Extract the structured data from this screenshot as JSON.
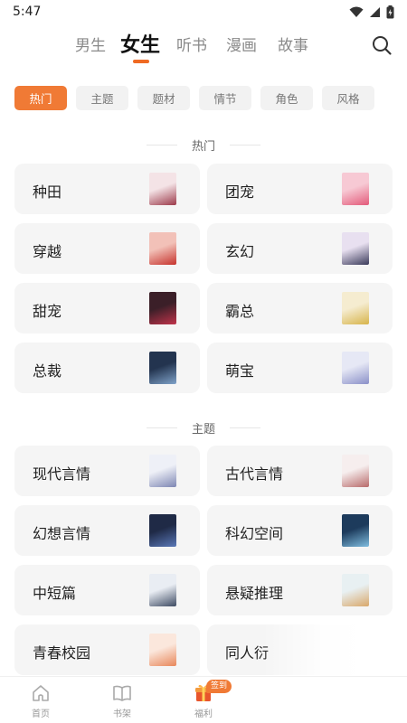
{
  "status_bar": {
    "time": "5:47"
  },
  "top_tabs": [
    {
      "label": "男生",
      "active": false
    },
    {
      "label": "女生",
      "active": true
    },
    {
      "label": "听书",
      "active": false
    },
    {
      "label": "漫画",
      "active": false
    },
    {
      "label": "故事",
      "active": false
    }
  ],
  "filter_chips": [
    {
      "label": "热门",
      "active": true
    },
    {
      "label": "主题",
      "active": false
    },
    {
      "label": "题材",
      "active": false
    },
    {
      "label": "情节",
      "active": false
    },
    {
      "label": "角色",
      "active": false
    },
    {
      "label": "风格",
      "active": false
    }
  ],
  "sections": [
    {
      "title": "热门",
      "items": [
        {
          "label": "种田",
          "cover_colors": [
            "#f4e3e6",
            "#9c3a4a"
          ]
        },
        {
          "label": "团宠",
          "cover_colors": [
            "#f7c9d4",
            "#e35a7a"
          ]
        },
        {
          "label": "穿越",
          "cover_colors": [
            "#f2c1b8",
            "#c6332d"
          ]
        },
        {
          "label": "玄幻",
          "cover_colors": [
            "#e8e0f0",
            "#3a3a5a"
          ]
        },
        {
          "label": "甜宠",
          "cover_colors": [
            "#3b1f28",
            "#c0334a"
          ]
        },
        {
          "label": "霸总",
          "cover_colors": [
            "#f5ecd0",
            "#d7b44a"
          ]
        },
        {
          "label": "总裁",
          "cover_colors": [
            "#23344f",
            "#7fa2c9"
          ]
        },
        {
          "label": "萌宝",
          "cover_colors": [
            "#e6e8f5",
            "#8a90c8"
          ]
        }
      ]
    },
    {
      "title": "主题",
      "items": [
        {
          "label": "现代言情",
          "cover_colors": [
            "#eef0f7",
            "#7d86b3"
          ]
        },
        {
          "label": "古代言情",
          "cover_colors": [
            "#f6eeee",
            "#b86a6a"
          ]
        },
        {
          "label": "幻想言情",
          "cover_colors": [
            "#1f2a46",
            "#5a78b8"
          ]
        },
        {
          "label": "科幻空间",
          "cover_colors": [
            "#1d3b5c",
            "#7fbde0"
          ]
        },
        {
          "label": "中短篇",
          "cover_colors": [
            "#e9edf3",
            "#3d4a62"
          ]
        },
        {
          "label": "悬疑推理",
          "cover_colors": [
            "#e8f0f2",
            "#d9a86a"
          ]
        },
        {
          "label": "青春校园",
          "cover_colors": [
            "#fbe7dc",
            "#e8875a"
          ]
        },
        {
          "label": "同人衍",
          "cover_colors": [
            "#ffffff",
            "#ffffff"
          ]
        }
      ]
    }
  ],
  "bottom_nav": [
    {
      "label": "首页",
      "icon": "home-icon"
    },
    {
      "label": "书架",
      "icon": "book-icon"
    },
    {
      "label": "福利",
      "icon": "gift-icon"
    }
  ],
  "badge_label": "签到",
  "accent_color": "#f07a35"
}
